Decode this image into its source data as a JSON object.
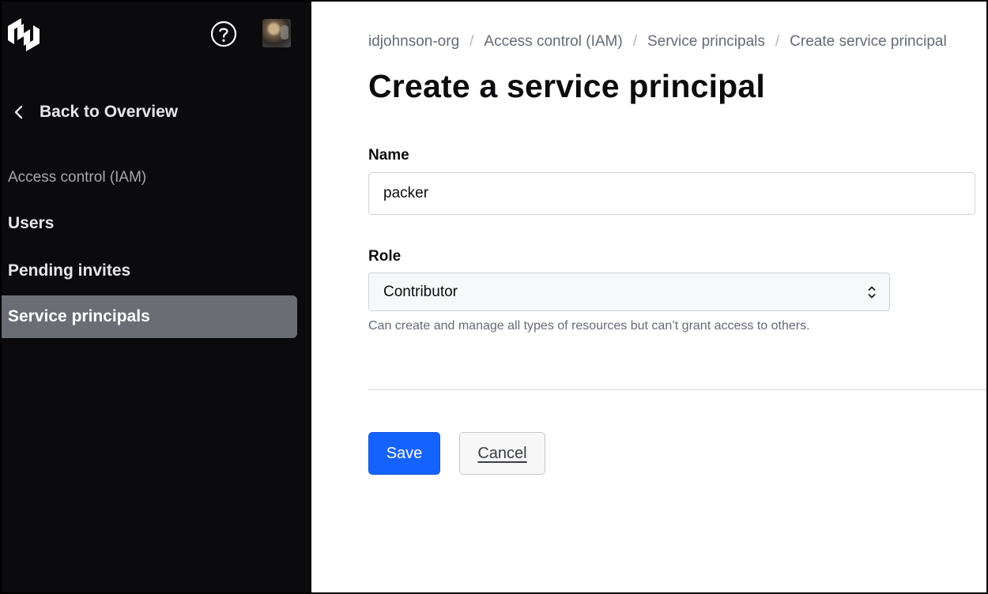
{
  "sidebar": {
    "back_label": "Back to Overview",
    "section_label": "Access control (IAM)",
    "items": [
      {
        "label": "Users",
        "active": false
      },
      {
        "label": "Pending invites",
        "active": false
      },
      {
        "label": "Service principals",
        "active": true
      }
    ]
  },
  "breadcrumb": [
    "idjohnson-org",
    "Access control (IAM)",
    "Service principals",
    "Create service principal"
  ],
  "page": {
    "title": "Create a service principal"
  },
  "form": {
    "name_label": "Name",
    "name_value": "packer",
    "role_label": "Role",
    "role_value": "Contributor",
    "role_help": "Can create and manage all types of resources but can’t grant access to others."
  },
  "actions": {
    "save_label": "Save",
    "cancel_label": "Cancel"
  },
  "colors": {
    "sidebar_bg": "#0b0b0d",
    "active_item_bg": "#6b6d75",
    "primary": "#1563ff"
  },
  "icons": {
    "logo": "hashicorp-logo-icon",
    "help": "help-circle-icon",
    "back": "chevron-left-icon",
    "select": "chevron-up-down-icon"
  }
}
